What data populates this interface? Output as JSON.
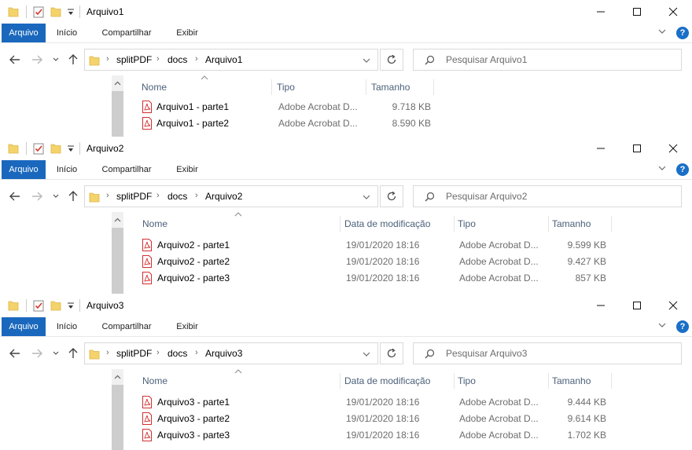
{
  "ribbon": {
    "file": "Arquivo",
    "inicio": "Início",
    "compartilhar": "Compartilhar",
    "exibir": "Exibir",
    "help": "?"
  },
  "windows": [
    {
      "title": "Arquivo1",
      "breadcrumb": [
        "splitPDF",
        "docs",
        "Arquivo1"
      ],
      "search_placeholder": "Pesquisar Arquivo1",
      "columns": {
        "name": "Nome",
        "type": "Tipo",
        "size": "Tamanho"
      },
      "files": [
        {
          "name": "Arquivo1 - parte1",
          "type": "Adobe Acrobat D...",
          "size": "9.718 KB"
        },
        {
          "name": "Arquivo1 - parte2",
          "type": "Adobe Acrobat D...",
          "size": "8.590 KB"
        }
      ]
    },
    {
      "title": "Arquivo2",
      "breadcrumb": [
        "splitPDF",
        "docs",
        "Arquivo2"
      ],
      "search_placeholder": "Pesquisar Arquivo2",
      "columns": {
        "name": "Nome",
        "date": "Data de modificação",
        "type": "Tipo",
        "size": "Tamanho"
      },
      "files": [
        {
          "name": "Arquivo2 - parte1",
          "date": "19/01/2020 18:16",
          "type": "Adobe Acrobat D...",
          "size": "9.599 KB"
        },
        {
          "name": "Arquivo2 - parte2",
          "date": "19/01/2020 18:16",
          "type": "Adobe Acrobat D...",
          "size": "9.427 KB"
        },
        {
          "name": "Arquivo2 - parte3",
          "date": "19/01/2020 18:16",
          "type": "Adobe Acrobat D...",
          "size": "857 KB"
        }
      ]
    },
    {
      "title": "Arquivo3",
      "breadcrumb": [
        "splitPDF",
        "docs",
        "Arquivo3"
      ],
      "search_placeholder": "Pesquisar Arquivo3",
      "columns": {
        "name": "Nome",
        "date": "Data de modificação",
        "type": "Tipo",
        "size": "Tamanho"
      },
      "files": [
        {
          "name": "Arquivo3 - parte1",
          "date": "19/01/2020 18:16",
          "type": "Adobe Acrobat D...",
          "size": "9.444 KB"
        },
        {
          "name": "Arquivo3 - parte2",
          "date": "19/01/2020 18:16",
          "type": "Adobe Acrobat D...",
          "size": "9.614 KB"
        },
        {
          "name": "Arquivo3 - parte3",
          "date": "19/01/2020 18:16",
          "type": "Adobe Acrobat D...",
          "size": "1.702 KB"
        }
      ]
    }
  ],
  "colors": {
    "file_tab": "#1a68bd",
    "pdf_red": "#d32f2f",
    "folder_yellow": "#f5d36b",
    "column_header_text": "#4c607a"
  },
  "icons": {
    "quick_access": [
      "folder-icon",
      "properties-check-icon",
      "new-folder-icon",
      "customize-dropdown-icon"
    ],
    "window_controls": [
      "minimize-icon",
      "maximize-icon",
      "close-icon"
    ],
    "navigation": [
      "back-arrow-icon",
      "forward-arrow-icon",
      "recent-locations-chevron-icon",
      "up-arrow-icon",
      "refresh-icon",
      "search-icon"
    ],
    "file": "pdf-file-icon"
  }
}
